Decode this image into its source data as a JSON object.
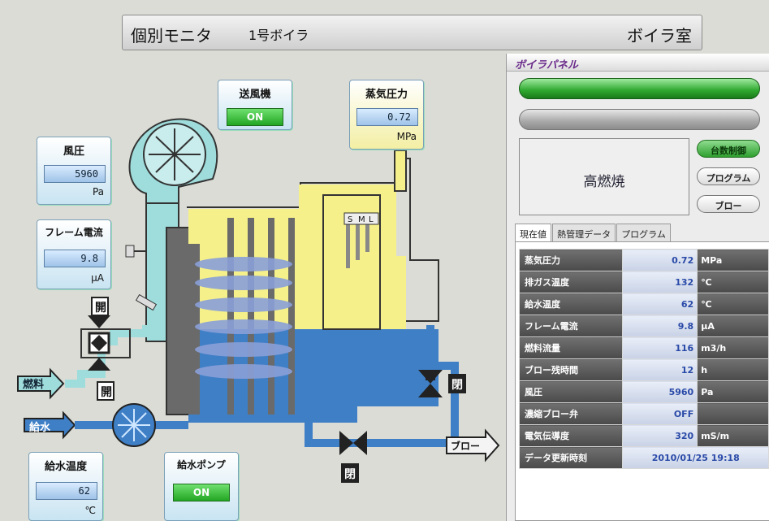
{
  "header": {
    "title": "個別モニタ",
    "unit": "1号ボイラ",
    "location": "ボイラ室"
  },
  "monitors": {
    "fan": {
      "label": "送風機",
      "value": "ON"
    },
    "steam_pressure": {
      "label": "蒸気圧力",
      "value": "0.72",
      "unit": "MPa"
    },
    "air_pressure": {
      "label": "風圧",
      "value": "5960",
      "unit": "Pa"
    },
    "flame_current": {
      "label": "フレーム電流",
      "value": "9.8",
      "unit": "μA"
    },
    "feedwater_temp": {
      "label": "給水温度",
      "value": "62",
      "unit": "℃"
    },
    "feed_pump": {
      "label": "給水ポンプ",
      "value": "ON"
    }
  },
  "diagram": {
    "fuel": "燃料",
    "feedwater": "給水",
    "blow": "ブロー",
    "closed": "閉",
    "level_labels": [
      "S",
      "M",
      "L"
    ]
  },
  "panel": {
    "title": "ボイラパネル",
    "state": "高燃焼",
    "buttons": [
      "台数制御",
      "プログラム",
      "ブロー"
    ],
    "tabs": [
      "現在値",
      "熱管理データ",
      "プログラム"
    ],
    "rows": [
      {
        "name": "蒸気圧力",
        "value": "0.72",
        "unit": "MPa"
      },
      {
        "name": "排ガス温度",
        "value": "132",
        "unit": "℃"
      },
      {
        "name": "給水温度",
        "value": "62",
        "unit": "℃"
      },
      {
        "name": "フレーム電流",
        "value": "9.8",
        "unit": "μA"
      },
      {
        "name": "燃料流量",
        "value": "116",
        "unit": "m3/h"
      },
      {
        "name": "ブロー残時間",
        "value": "12",
        "unit": "h"
      },
      {
        "name": "風圧",
        "value": "5960",
        "unit": "Pa"
      },
      {
        "name": "濃縮ブロー弁",
        "value": "OFF",
        "unit": ""
      },
      {
        "name": "電気伝導度",
        "value": "320",
        "unit": "mS/m"
      }
    ],
    "update_label": "データ更新時刻",
    "update_time": "2010/01/25 19:18"
  },
  "colors": {
    "water": "#3f7fc6",
    "steam": "#f5f08a",
    "pipe_light": "#9fdcdc",
    "metal": "#6a6a6a",
    "on": "#2ea82e"
  }
}
